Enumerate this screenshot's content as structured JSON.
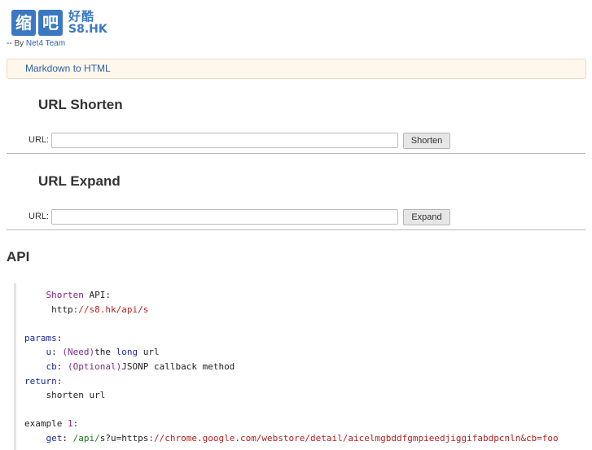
{
  "logo": {
    "chars_main_1": "缩",
    "chars_main_2": "吧",
    "chars_small": "好酷",
    "domain": "S8.HK"
  },
  "byline": {
    "prefix": "-- By ",
    "team": "Net4 Team"
  },
  "nav": {
    "link": "Markdown to HTML"
  },
  "shorten": {
    "title": "URL Shorten",
    "label": "URL:",
    "input_value": "",
    "button": "Shorten"
  },
  "expand": {
    "title": "URL Expand",
    "label": "URL:",
    "input_value": "",
    "button": "Expand"
  },
  "api": {
    "title": "API",
    "lines": {
      "l1a": "Shorten",
      "l1b": " API:",
      "l2a": "http",
      "l2b": "://s8.hk/api/s",
      "l4a": "params",
      "l4b": ":",
      "l5a": "u",
      "l5b": ": ",
      "l5c": "(Need)",
      "l5d": "the ",
      "l5e": "long",
      "l5f": " url",
      "l6a": "cb",
      "l6b": ": ",
      "l6c": "(Optional)",
      "l6d": "JSONP callback method",
      "l7a": "return",
      "l7b": ":",
      "l8": "shorten url",
      "l10a": "example ",
      "l10b": "1",
      "l10c": ":",
      "l11a": "get",
      "l11b": ": ",
      "l11c": "/api/",
      "l11d": "s?u=https",
      "l11e": "://chrome.google.com/webstore/detail/aicelmgbddfgmpieedjiggifabdpcnln&cb=foo"
    }
  }
}
